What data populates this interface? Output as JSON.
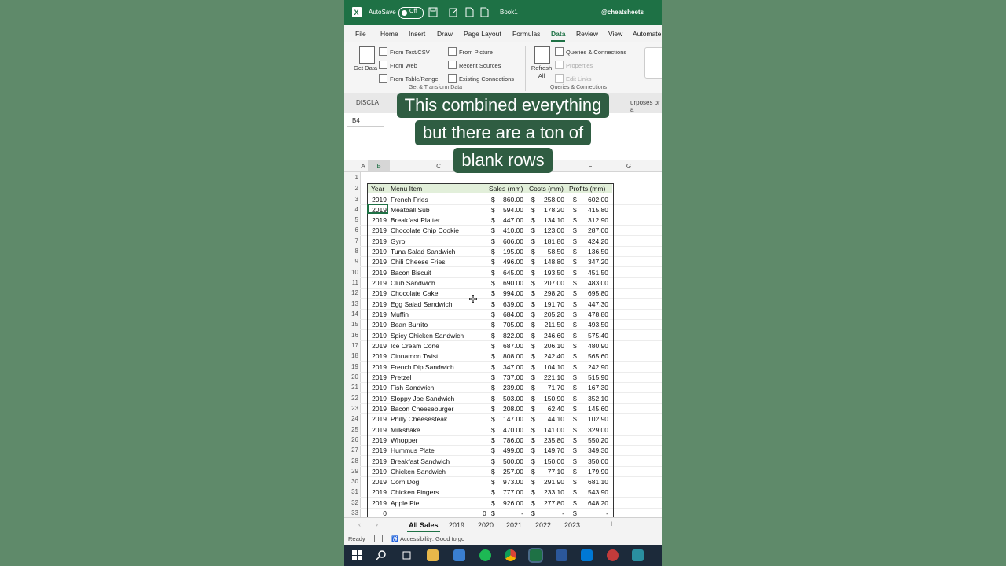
{
  "titlebar": {
    "autosave_label": "AutoSave",
    "autosave_state": "Off",
    "book_name": "Book1",
    "handle": "@cheatsheets"
  },
  "menu": [
    "File",
    "Home",
    "Insert",
    "Draw",
    "Page Layout",
    "Formulas",
    "Data",
    "Review",
    "View",
    "Automate"
  ],
  "menu_active": "Data",
  "ribbon": {
    "get_data": "Get Data",
    "from_text_csv": "From Text/CSV",
    "from_web": "From Web",
    "from_table_range": "From Table/Range",
    "from_picture": "From Picture",
    "recent_sources": "Recent Sources",
    "existing_connections": "Existing Connections",
    "group1_label": "Get & Transform Data",
    "refresh_all": "Refresh All",
    "queries_connections": "Queries & Connections",
    "properties": "Properties",
    "edit_links": "Edit Links",
    "group2_label": "Queries & Connections"
  },
  "infobar": {
    "left": "DISCLA",
    "right": "urposes or a"
  },
  "namebox": "B4",
  "caption": [
    "This combined everything",
    "but there are a ton of",
    "blank rows"
  ],
  "columns": [
    "A",
    "B",
    "C",
    "D",
    "E",
    "F",
    "G"
  ],
  "table_header": {
    "year": "Year",
    "item": "Menu Item",
    "sales": "Sales (mm)",
    "costs": "Costs (mm)",
    "profits": "Profits (mm)"
  },
  "currency": "$",
  "rows": [
    {
      "n": "3",
      "year": "2019",
      "item": "French Fries",
      "sales": "860.00",
      "costs": "258.00",
      "profits": "602.00"
    },
    {
      "n": "4",
      "year": "2019",
      "item": "Meatball Sub",
      "sales": "594.00",
      "costs": "178.20",
      "profits": "415.80"
    },
    {
      "n": "5",
      "year": "2019",
      "item": "Breakfast Platter",
      "sales": "447.00",
      "costs": "134.10",
      "profits": "312.90"
    },
    {
      "n": "6",
      "year": "2019",
      "item": "Chocolate Chip Cookie",
      "sales": "410.00",
      "costs": "123.00",
      "profits": "287.00"
    },
    {
      "n": "7",
      "year": "2019",
      "item": "Gyro",
      "sales": "606.00",
      "costs": "181.80",
      "profits": "424.20"
    },
    {
      "n": "8",
      "year": "2019",
      "item": "Tuna Salad Sandwich",
      "sales": "195.00",
      "costs": "58.50",
      "profits": "136.50"
    },
    {
      "n": "9",
      "year": "2019",
      "item": "Chili Cheese Fries",
      "sales": "496.00",
      "costs": "148.80",
      "profits": "347.20"
    },
    {
      "n": "10",
      "year": "2019",
      "item": "Bacon Biscuit",
      "sales": "645.00",
      "costs": "193.50",
      "profits": "451.50"
    },
    {
      "n": "11",
      "year": "2019",
      "item": "Club Sandwich",
      "sales": "690.00",
      "costs": "207.00",
      "profits": "483.00"
    },
    {
      "n": "12",
      "year": "2019",
      "item": "Chocolate Cake",
      "sales": "994.00",
      "costs": "298.20",
      "profits": "695.80"
    },
    {
      "n": "13",
      "year": "2019",
      "item": "Egg Salad Sandwich",
      "sales": "639.00",
      "costs": "191.70",
      "profits": "447.30"
    },
    {
      "n": "14",
      "year": "2019",
      "item": "Muffin",
      "sales": "684.00",
      "costs": "205.20",
      "profits": "478.80"
    },
    {
      "n": "15",
      "year": "2019",
      "item": "Bean Burrito",
      "sales": "705.00",
      "costs": "211.50",
      "profits": "493.50"
    },
    {
      "n": "16",
      "year": "2019",
      "item": "Spicy Chicken Sandwich",
      "sales": "822.00",
      "costs": "246.60",
      "profits": "575.40"
    },
    {
      "n": "17",
      "year": "2019",
      "item": "Ice Cream Cone",
      "sales": "687.00",
      "costs": "206.10",
      "profits": "480.90"
    },
    {
      "n": "18",
      "year": "2019",
      "item": "Cinnamon Twist",
      "sales": "808.00",
      "costs": "242.40",
      "profits": "565.60"
    },
    {
      "n": "19",
      "year": "2019",
      "item": "French Dip Sandwich",
      "sales": "347.00",
      "costs": "104.10",
      "profits": "242.90"
    },
    {
      "n": "20",
      "year": "2019",
      "item": "Pretzel",
      "sales": "737.00",
      "costs": "221.10",
      "profits": "515.90"
    },
    {
      "n": "21",
      "year": "2019",
      "item": "Fish Sandwich",
      "sales": "239.00",
      "costs": "71.70",
      "profits": "167.30"
    },
    {
      "n": "22",
      "year": "2019",
      "item": "Sloppy Joe Sandwich",
      "sales": "503.00",
      "costs": "150.90",
      "profits": "352.10"
    },
    {
      "n": "23",
      "year": "2019",
      "item": "Bacon Cheeseburger",
      "sales": "208.00",
      "costs": "62.40",
      "profits": "145.60"
    },
    {
      "n": "24",
      "year": "2019",
      "item": "Philly Cheesesteak",
      "sales": "147.00",
      "costs": "44.10",
      "profits": "102.90"
    },
    {
      "n": "25",
      "year": "2019",
      "item": "Milkshake",
      "sales": "470.00",
      "costs": "141.00",
      "profits": "329.00"
    },
    {
      "n": "26",
      "year": "2019",
      "item": "Whopper",
      "sales": "786.00",
      "costs": "235.80",
      "profits": "550.20"
    },
    {
      "n": "27",
      "year": "2019",
      "item": "Hummus Plate",
      "sales": "499.00",
      "costs": "149.70",
      "profits": "349.30"
    },
    {
      "n": "28",
      "year": "2019",
      "item": "Breakfast Sandwich",
      "sales": "500.00",
      "costs": "150.00",
      "profits": "350.00"
    },
    {
      "n": "29",
      "year": "2019",
      "item": "Chicken Sandwich",
      "sales": "257.00",
      "costs": "77.10",
      "profits": "179.90"
    },
    {
      "n": "30",
      "year": "2019",
      "item": "Corn Dog",
      "sales": "973.00",
      "costs": "291.90",
      "profits": "681.10"
    },
    {
      "n": "31",
      "year": "2019",
      "item": "Chicken Fingers",
      "sales": "777.00",
      "costs": "233.10",
      "profits": "543.90"
    },
    {
      "n": "32",
      "year": "2019",
      "item": "Apple Pie",
      "sales": "926.00",
      "costs": "277.80",
      "profits": "648.20"
    },
    {
      "n": "33",
      "year": "0",
      "item": "0",
      "sales": "-",
      "costs": "-",
      "profits": "-"
    }
  ],
  "sheets": [
    "All Sales",
    "2019",
    "2020",
    "2021",
    "2022",
    "2023"
  ],
  "active_sheet": "All Sales",
  "status": {
    "ready": "Ready",
    "accessibility": "Accessibility: Good to go"
  },
  "colors": {
    "excel_green": "#1e7145",
    "caption_bg": "#2f5d42",
    "page_bg": "#5f8a6a",
    "header_fill": "#e2efda"
  }
}
